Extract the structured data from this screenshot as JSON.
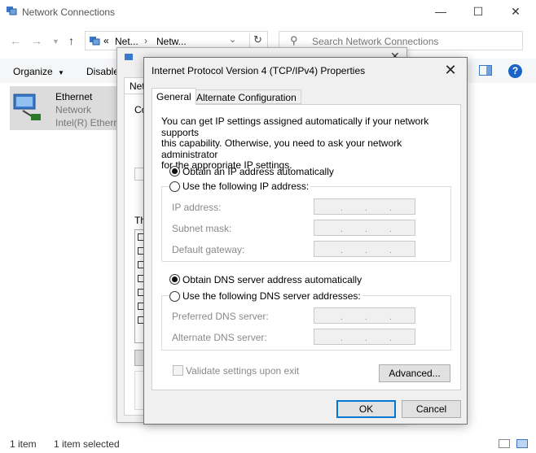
{
  "explorer": {
    "title": "Network Connections",
    "address_part1": "Net...",
    "address_part2": "Netw...",
    "address_prefix": "«",
    "search_placeholder": "Search Network Connections",
    "organize_label": "Organize",
    "disable_label": "Disable",
    "item": {
      "name": "Ethernet",
      "status": "Network",
      "device": "Intel(R) Etherne"
    },
    "status": {
      "count": "1 item",
      "selected": "1 item selected"
    }
  },
  "eth_window": {
    "tab_label": "Netw",
    "connect_label": "Co",
    "this_label": "Th"
  },
  "dialog": {
    "title": "Internet Protocol Version 4 (TCP/IPv4) Properties",
    "tabs": [
      {
        "label": "General",
        "active": true
      },
      {
        "label": "Alternate Configuration",
        "active": false
      }
    ],
    "intro": [
      "You can get IP settings assigned automatically if your network supports",
      "this capability. Otherwise, you need to ask your network administrator",
      "for the appropriate IP settings."
    ],
    "ip_auto_label": "Obtain an IP address automatically",
    "ip_manual_label": "Use the following IP address:",
    "ip_fields": [
      {
        "label": "IP address:"
      },
      {
        "label": "Subnet mask:"
      },
      {
        "label": "Default gateway:"
      }
    ],
    "dns_auto_label": "Obtain DNS server address automatically",
    "dns_manual_label": "Use the following DNS server addresses:",
    "dns_fields": [
      {
        "label": "Preferred DNS server:"
      },
      {
        "label": "Alternate DNS server:"
      }
    ],
    "validate_label": "Validate settings upon exit",
    "advanced_label": "Advanced...",
    "ok_label": "OK",
    "cancel_label": "Cancel",
    "ip_mode": "auto",
    "dns_mode": "auto",
    "validate_checked": false
  },
  "colors": {
    "accent": "#0078d7",
    "help": "#1a64c8"
  }
}
